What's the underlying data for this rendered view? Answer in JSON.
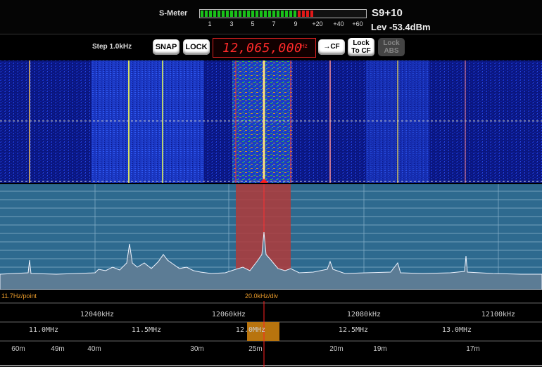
{
  "smeter": {
    "label": "S-Meter",
    "scale": [
      "1",
      "3",
      "5",
      "7",
      "9",
      "+20",
      "+40",
      "+60"
    ],
    "reading": "S9+10",
    "level": "Lev -53.4dBm",
    "fill_fraction": 0.7,
    "colors": {
      "green": "#19c219",
      "red": "#e01818",
      "empty": "#111111"
    }
  },
  "controls": {
    "step": "Step 1.0kHz",
    "snap": "SNAP",
    "lock": "LOCK",
    "frequency": "12,065,000",
    "freq_unit": "Hz",
    "to_cf": "→CF",
    "lock_to_cf": [
      "Lock",
      "To CF"
    ],
    "lock_abs": [
      "Lock",
      "ABS"
    ]
  },
  "spectrum": {
    "resolution": "11.7Hz/point",
    "division": "20.0kHz/div",
    "colors": {
      "fill": "#5c7c95",
      "passband": "#b03a3a",
      "grid_bg": "#2e6a8f"
    }
  },
  "scales": {
    "khz_labels": [
      "12040kHz",
      "12060kHz",
      "12080kHz",
      "12100kHz"
    ],
    "mhz_labels": [
      "11.0MHz",
      "11.5MHz",
      "12.0MHz",
      "12.5MHz",
      "13.0MHz"
    ],
    "band_labels": [
      "60m",
      "49m",
      "40m",
      "30m",
      "25m",
      "20m",
      "19m",
      "17m"
    ]
  }
}
